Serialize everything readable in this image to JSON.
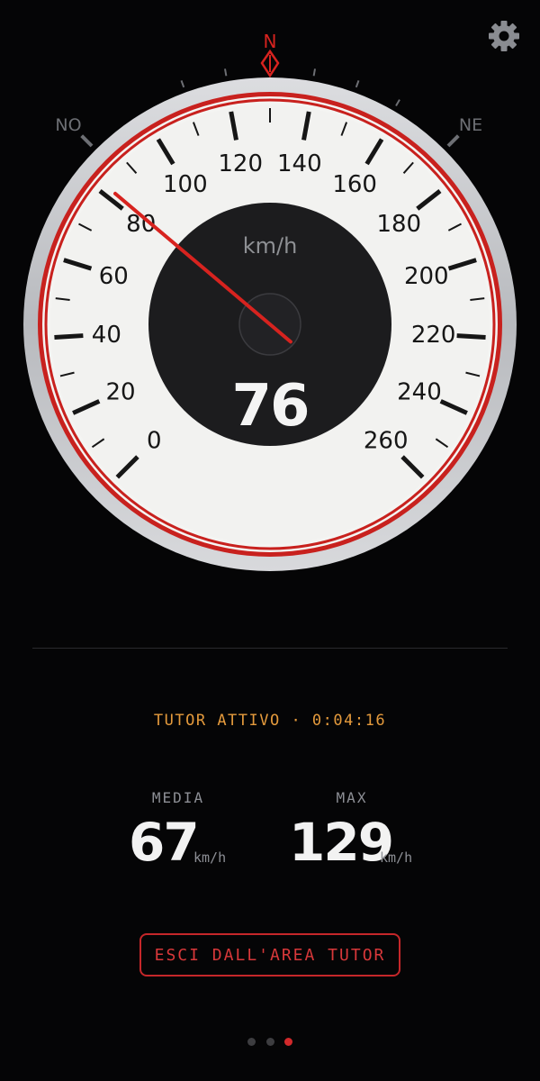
{
  "gauge": {
    "speed": 76,
    "unit": "km/h",
    "max": 260,
    "scale_labels": [
      "0",
      "20",
      "40",
      "60",
      "80",
      "100",
      "120",
      "140",
      "160",
      "180",
      "200",
      "220",
      "240",
      "260"
    ],
    "needle_value": 82,
    "compass": {
      "north": "N",
      "left": "NO",
      "right": "NE"
    },
    "colors": {
      "needle": "#d7231f",
      "ring": "#c8211e",
      "face": "#f2f2f0",
      "hub": "#1c1c1e"
    }
  },
  "settings": {
    "icon": "gear-icon"
  },
  "tutor": {
    "status": "TUTOR ATTIVO · 0:04:16"
  },
  "stats": {
    "average": {
      "label": "MEDIA",
      "value": "67",
      "unit": "km/h"
    },
    "max": {
      "label": "MAX",
      "value": "129",
      "unit": "km/h"
    }
  },
  "exit_button": {
    "label": "ESCI DALL'AREA TUTOR"
  },
  "pager": {
    "count": 3,
    "active": 3
  }
}
